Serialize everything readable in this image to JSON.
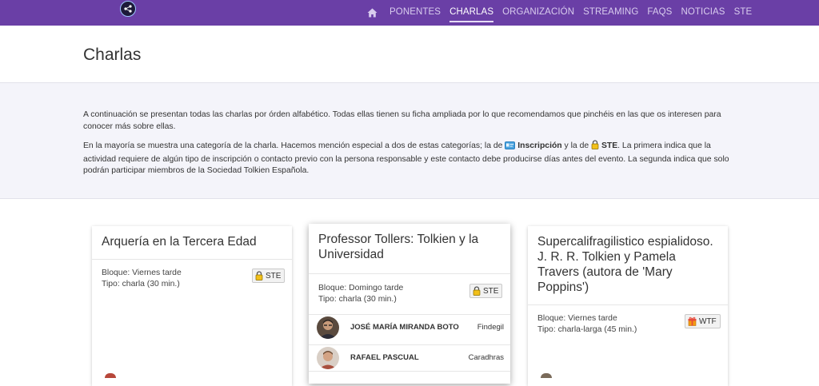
{
  "colors": {
    "navbar": "#6a3fa6",
    "nav_text": "#d9cdee",
    "nav_active": "#ffffff",
    "intro_bg": "#f4f4fa"
  },
  "nav": {
    "logo_text": "",
    "home_icon": "home-icon",
    "items": [
      "PONENTES",
      "CHARLAS",
      "ORGANIZACIÓN",
      "STREAMING",
      "FAQS",
      "NOTICIAS",
      "STE"
    ],
    "active": "CHARLAS"
  },
  "page": {
    "title": "Charlas"
  },
  "intro": {
    "p1": "A continuación se presentan todas las charlas por órden alfabético. Todas ellas tienen su ficha ampliada por lo que recomendamos que pinchéis en las que os interesen para conocer más sobre ellas.",
    "p2_a": "En la mayoría se muestra una categoría de la charla. Hacemos mención especial a dos de estas categorías; la de ",
    "p2_insc": "Inscripción",
    "p2_b": " y la de ",
    "p2_ste": "STE",
    "p2_c": ". La primera indica que la actividad requiere de algún tipo de inscripción o contacto previo con la persona responsable y este contacto debe producirse días antes del evento. La segunda indica que solo podrán participar miembros de la Sociedad Tolkien Española."
  },
  "cards": [
    {
      "title": "Arquería en la Tercera Edad",
      "bloque": "Bloque: Viernes tarde",
      "tipo": "Tipo: charla (30 min.)",
      "badge": "STE",
      "badge_icon": "lock-icon"
    },
    {
      "title": "Professor Tollers: Tolkien y la Universidad",
      "bloque": "Bloque: Domingo tarde",
      "tipo": "Tipo: charla (30 min.)",
      "badge": "STE",
      "badge_icon": "lock-icon",
      "speakers": [
        {
          "name": "JOSÉ MARÍA MIRANDA BOTO",
          "org": "Findegil"
        },
        {
          "name": "RAFAEL PASCUAL",
          "org": "Caradhras"
        }
      ]
    },
    {
      "title": "Supercalifragilistico espialidoso. J. R. R. Tolkien y Pamela Travers (autora de 'Mary Poppins')",
      "bloque": "Bloque: Viernes tarde",
      "tipo": "Tipo: charla-larga (45 min.)",
      "badge": "WTF",
      "badge_icon": "gift-icon"
    }
  ]
}
